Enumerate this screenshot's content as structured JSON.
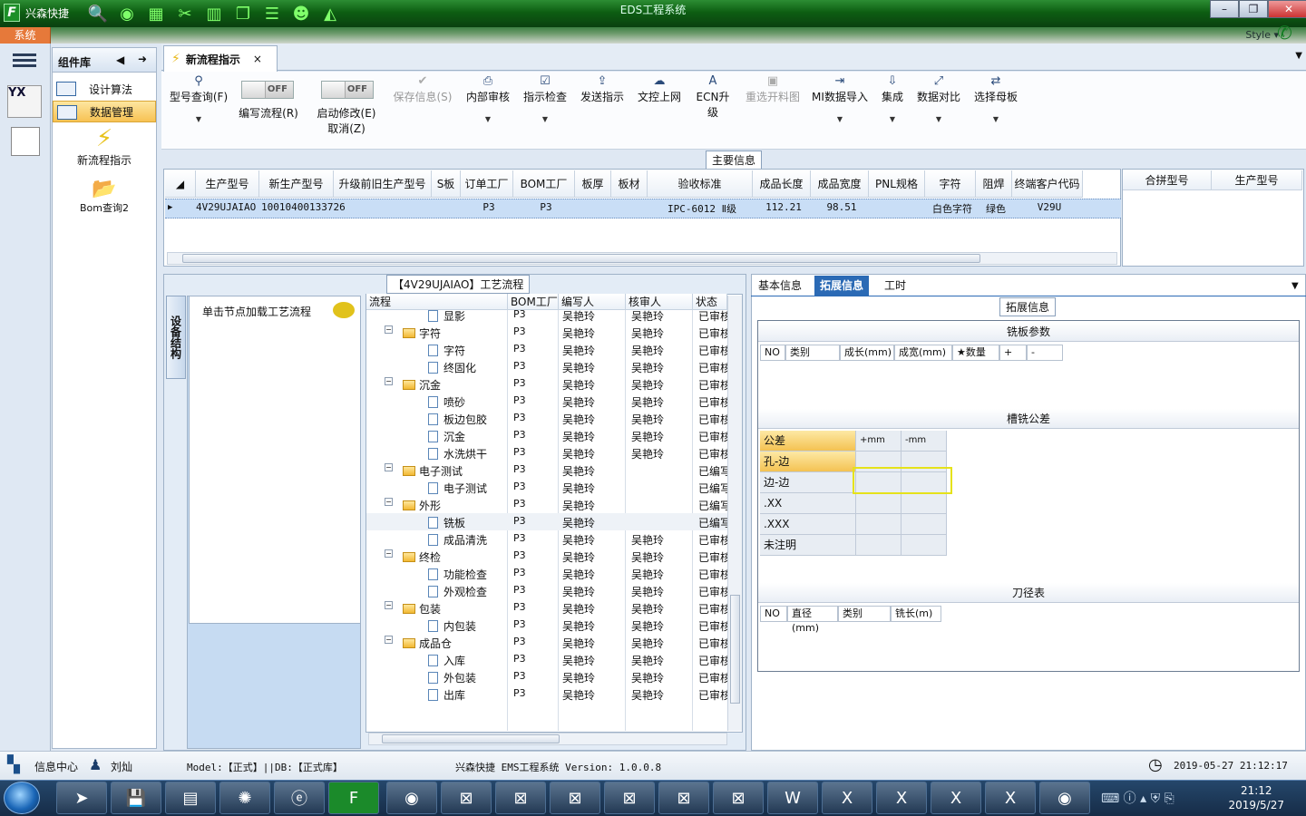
{
  "app": {
    "brand": "兴森快捷",
    "window_title": "EDS工程系统",
    "menu_sys": "系统",
    "style_label": "Style ▾"
  },
  "sidebar": {
    "header": "组件库",
    "items": [
      {
        "label": "设计算法"
      },
      {
        "label": "数据管理"
      }
    ],
    "big": [
      {
        "label": "新流程指示"
      },
      {
        "label": "Bom查询2"
      }
    ]
  },
  "tab": {
    "label": "新流程指示",
    "close": "×"
  },
  "toolbar": {
    "buttons": [
      {
        "label": "型号查询(F)",
        "disabled": false
      },
      {
        "label": "保存信息(S)",
        "disabled": true
      },
      {
        "label": "内部审核",
        "disabled": false
      },
      {
        "label": "指示检查",
        "disabled": false
      },
      {
        "label": "发送指示",
        "disabled": false
      },
      {
        "label": "文控上网",
        "disabled": false
      },
      {
        "label": "ECN升级",
        "disabled": false
      },
      {
        "label": "重选开料图",
        "disabled": true
      },
      {
        "label": "MI数据导入",
        "disabled": false
      },
      {
        "label": "集成",
        "disabled": false
      },
      {
        "label": "数据对比",
        "disabled": false
      },
      {
        "label": "选择母板",
        "disabled": false
      }
    ],
    "toggle1": {
      "state": "OFF",
      "label": "编写流程(R)"
    },
    "toggle2": {
      "state": "OFF",
      "label": "启动修改(E)",
      "sub": "取消(Z)"
    }
  },
  "main_info": {
    "title": "主要信息",
    "columns": [
      "生产型号",
      "新生产型号",
      "升级前旧生产型号",
      "S板",
      "订单工厂",
      "BOM工厂",
      "板厚",
      "板材",
      "验收标准",
      "成品长度",
      "成品宽度",
      "PNL规格",
      "字符",
      "阻焊",
      "终端客户代码"
    ],
    "row": [
      "4V29UJAIAO",
      "10010400133726",
      "",
      "",
      "P3",
      "P3",
      "",
      "",
      "IPC-6012 Ⅱ级",
      "112.21",
      "98.51",
      "",
      "白色字符",
      "绿色",
      "V29U"
    ],
    "side_columns": [
      "合拼型号",
      "生产型号"
    ]
  },
  "process": {
    "title": "【4V29UJAIAO】工艺流程",
    "vtab": "设备结构",
    "note": "单击节点加载工艺流程",
    "columns": [
      "流程",
      "BOM工厂",
      "编写人",
      "核审人",
      "状态"
    ],
    "rows": [
      {
        "name": "显影",
        "lvl": 2,
        "bom": "P3",
        "w": "吴艳玲",
        "r": "吴艳玲",
        "s": "已审核"
      },
      {
        "name": "字符",
        "lvl": 1,
        "bom": "P3",
        "w": "吴艳玲",
        "r": "吴艳玲",
        "s": "已审核"
      },
      {
        "name": "字符",
        "lvl": 2,
        "bom": "P3",
        "w": "吴艳玲",
        "r": "吴艳玲",
        "s": "已审核"
      },
      {
        "name": "终固化",
        "lvl": 2,
        "bom": "P3",
        "w": "吴艳玲",
        "r": "吴艳玲",
        "s": "已审核"
      },
      {
        "name": "沉金",
        "lvl": 1,
        "bom": "P3",
        "w": "吴艳玲",
        "r": "吴艳玲",
        "s": "已审核"
      },
      {
        "name": "喷砂",
        "lvl": 2,
        "bom": "P3",
        "w": "吴艳玲",
        "r": "吴艳玲",
        "s": "已审核"
      },
      {
        "name": "板边包胶",
        "lvl": 2,
        "bom": "P3",
        "w": "吴艳玲",
        "r": "吴艳玲",
        "s": "已审核"
      },
      {
        "name": "沉金",
        "lvl": 2,
        "bom": "P3",
        "w": "吴艳玲",
        "r": "吴艳玲",
        "s": "已审核"
      },
      {
        "name": "水洗烘干",
        "lvl": 2,
        "bom": "P3",
        "w": "吴艳玲",
        "r": "吴艳玲",
        "s": "已审核"
      },
      {
        "name": "电子测试",
        "lvl": 1,
        "bom": "P3",
        "w": "吴艳玲",
        "r": "",
        "s": "已编写"
      },
      {
        "name": "电子测试",
        "lvl": 2,
        "bom": "P3",
        "w": "吴艳玲",
        "r": "",
        "s": "已编写"
      },
      {
        "name": "外形",
        "lvl": 1,
        "bom": "P3",
        "w": "吴艳玲",
        "r": "",
        "s": "已编写"
      },
      {
        "name": "铣板",
        "lvl": 2,
        "bom": "P3",
        "w": "吴艳玲",
        "r": "",
        "s": "已编写"
      },
      {
        "name": "成品清洗",
        "lvl": 2,
        "bom": "P3",
        "w": "吴艳玲",
        "r": "吴艳玲",
        "s": "已审核"
      },
      {
        "name": "终检",
        "lvl": 1,
        "bom": "P3",
        "w": "吴艳玲",
        "r": "吴艳玲",
        "s": "已审核"
      },
      {
        "name": "功能检查",
        "lvl": 2,
        "bom": "P3",
        "w": "吴艳玲",
        "r": "吴艳玲",
        "s": "已审核"
      },
      {
        "name": "外观检查",
        "lvl": 2,
        "bom": "P3",
        "w": "吴艳玲",
        "r": "吴艳玲",
        "s": "已审核"
      },
      {
        "name": "包装",
        "lvl": 1,
        "bom": "P3",
        "w": "吴艳玲",
        "r": "吴艳玲",
        "s": "已审核"
      },
      {
        "name": "内包装",
        "lvl": 2,
        "bom": "P3",
        "w": "吴艳玲",
        "r": "吴艳玲",
        "s": "已审核"
      },
      {
        "name": "成品仓",
        "lvl": 1,
        "bom": "P3",
        "w": "吴艳玲",
        "r": "吴艳玲",
        "s": "已审核"
      },
      {
        "name": "入库",
        "lvl": 2,
        "bom": "P3",
        "w": "吴艳玲",
        "r": "吴艳玲",
        "s": "已审核"
      },
      {
        "name": "外包装",
        "lvl": 2,
        "bom": "P3",
        "w": "吴艳玲",
        "r": "吴艳玲",
        "s": "已审核"
      },
      {
        "name": "出库",
        "lvl": 2,
        "bom": "P3",
        "w": "吴艳玲",
        "r": "吴艳玲",
        "s": "已审核"
      }
    ]
  },
  "right": {
    "tabs": [
      "基本信息",
      "拓展信息",
      "工时"
    ],
    "section": "拓展信息",
    "mill_plate": {
      "title": "铣板参数",
      "cols": [
        "NO",
        "类别",
        "成长(mm)",
        "成宽(mm)",
        "★数量",
        "+",
        "-"
      ]
    },
    "tolerance": {
      "title": "槽铣公差",
      "head": [
        "公差",
        "+mm",
        "-mm"
      ],
      "rows": [
        "孔-边",
        "边-边",
        ".XX",
        ".XXX",
        "未注明"
      ]
    },
    "tools": {
      "title": "刀径表",
      "cols": [
        "NO",
        "直径(mm)",
        "类别",
        "铣长(m)"
      ]
    }
  },
  "status": {
    "info": "信息中心",
    "user": "刘灿",
    "model": "Model:【正式】||DB:【正式库】",
    "center": "兴森快捷 EMS工程系统 Version: 1.0.0.8",
    "datetime": "2019-05-27 21:12:17"
  },
  "taskbar": {
    "time": "21:12",
    "date": "2019/5/27"
  }
}
